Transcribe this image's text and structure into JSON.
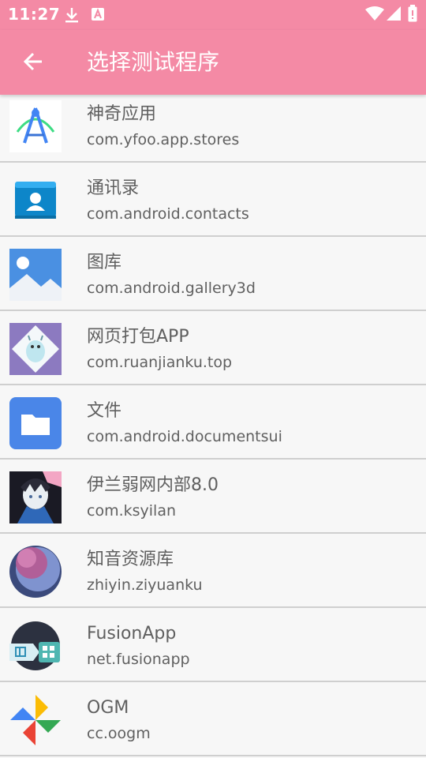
{
  "status_bar": {
    "time": "11:27"
  },
  "toolbar": {
    "title": "选择测试程序"
  },
  "apps": [
    {
      "name": "神奇应用",
      "package": "com.yfoo.app.stores"
    },
    {
      "name": "通讯录",
      "package": "com.android.contacts"
    },
    {
      "name": "图库",
      "package": "com.android.gallery3d"
    },
    {
      "name": "网页打包APP",
      "package": "com.ruanjianku.top"
    },
    {
      "name": "文件",
      "package": "com.android.documentsui"
    },
    {
      "name": "伊兰弱网内部8.0",
      "package": "com.ksyilan"
    },
    {
      "name": "知音资源库",
      "package": "zhiyin.ziyuanku"
    },
    {
      "name": "FusionApp",
      "package": "net.fusionapp"
    },
    {
      "name": "OGM",
      "package": "cc.oogm"
    }
  ],
  "colors": {
    "accent": "#f48aa5",
    "text": "#5f5f5f",
    "divider": "#cfcfcf"
  }
}
